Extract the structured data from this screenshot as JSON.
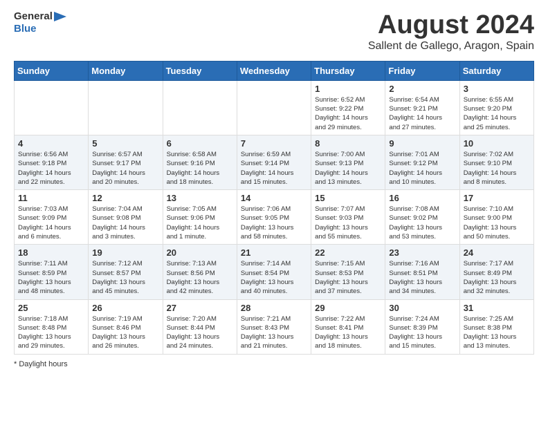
{
  "logo": {
    "general": "General",
    "blue": "Blue"
  },
  "title": "August 2024",
  "subtitle": "Sallent de Gallego, Aragon, Spain",
  "days_of_week": [
    "Sunday",
    "Monday",
    "Tuesday",
    "Wednesday",
    "Thursday",
    "Friday",
    "Saturday"
  ],
  "weeks": [
    [
      {
        "day": "",
        "info": ""
      },
      {
        "day": "",
        "info": ""
      },
      {
        "day": "",
        "info": ""
      },
      {
        "day": "",
        "info": ""
      },
      {
        "day": "1",
        "info": "Sunrise: 6:52 AM\nSunset: 9:22 PM\nDaylight: 14 hours\nand 29 minutes."
      },
      {
        "day": "2",
        "info": "Sunrise: 6:54 AM\nSunset: 9:21 PM\nDaylight: 14 hours\nand 27 minutes."
      },
      {
        "day": "3",
        "info": "Sunrise: 6:55 AM\nSunset: 9:20 PM\nDaylight: 14 hours\nand 25 minutes."
      }
    ],
    [
      {
        "day": "4",
        "info": "Sunrise: 6:56 AM\nSunset: 9:18 PM\nDaylight: 14 hours\nand 22 minutes."
      },
      {
        "day": "5",
        "info": "Sunrise: 6:57 AM\nSunset: 9:17 PM\nDaylight: 14 hours\nand 20 minutes."
      },
      {
        "day": "6",
        "info": "Sunrise: 6:58 AM\nSunset: 9:16 PM\nDaylight: 14 hours\nand 18 minutes."
      },
      {
        "day": "7",
        "info": "Sunrise: 6:59 AM\nSunset: 9:14 PM\nDaylight: 14 hours\nand 15 minutes."
      },
      {
        "day": "8",
        "info": "Sunrise: 7:00 AM\nSunset: 9:13 PM\nDaylight: 14 hours\nand 13 minutes."
      },
      {
        "day": "9",
        "info": "Sunrise: 7:01 AM\nSunset: 9:12 PM\nDaylight: 14 hours\nand 10 minutes."
      },
      {
        "day": "10",
        "info": "Sunrise: 7:02 AM\nSunset: 9:10 PM\nDaylight: 14 hours\nand 8 minutes."
      }
    ],
    [
      {
        "day": "11",
        "info": "Sunrise: 7:03 AM\nSunset: 9:09 PM\nDaylight: 14 hours\nand 6 minutes."
      },
      {
        "day": "12",
        "info": "Sunrise: 7:04 AM\nSunset: 9:08 PM\nDaylight: 14 hours\nand 3 minutes."
      },
      {
        "day": "13",
        "info": "Sunrise: 7:05 AM\nSunset: 9:06 PM\nDaylight: 14 hours\nand 1 minute."
      },
      {
        "day": "14",
        "info": "Sunrise: 7:06 AM\nSunset: 9:05 PM\nDaylight: 13 hours\nand 58 minutes."
      },
      {
        "day": "15",
        "info": "Sunrise: 7:07 AM\nSunset: 9:03 PM\nDaylight: 13 hours\nand 55 minutes."
      },
      {
        "day": "16",
        "info": "Sunrise: 7:08 AM\nSunset: 9:02 PM\nDaylight: 13 hours\nand 53 minutes."
      },
      {
        "day": "17",
        "info": "Sunrise: 7:10 AM\nSunset: 9:00 PM\nDaylight: 13 hours\nand 50 minutes."
      }
    ],
    [
      {
        "day": "18",
        "info": "Sunrise: 7:11 AM\nSunset: 8:59 PM\nDaylight: 13 hours\nand 48 minutes."
      },
      {
        "day": "19",
        "info": "Sunrise: 7:12 AM\nSunset: 8:57 PM\nDaylight: 13 hours\nand 45 minutes."
      },
      {
        "day": "20",
        "info": "Sunrise: 7:13 AM\nSunset: 8:56 PM\nDaylight: 13 hours\nand 42 minutes."
      },
      {
        "day": "21",
        "info": "Sunrise: 7:14 AM\nSunset: 8:54 PM\nDaylight: 13 hours\nand 40 minutes."
      },
      {
        "day": "22",
        "info": "Sunrise: 7:15 AM\nSunset: 8:53 PM\nDaylight: 13 hours\nand 37 minutes."
      },
      {
        "day": "23",
        "info": "Sunrise: 7:16 AM\nSunset: 8:51 PM\nDaylight: 13 hours\nand 34 minutes."
      },
      {
        "day": "24",
        "info": "Sunrise: 7:17 AM\nSunset: 8:49 PM\nDaylight: 13 hours\nand 32 minutes."
      }
    ],
    [
      {
        "day": "25",
        "info": "Sunrise: 7:18 AM\nSunset: 8:48 PM\nDaylight: 13 hours\nand 29 minutes."
      },
      {
        "day": "26",
        "info": "Sunrise: 7:19 AM\nSunset: 8:46 PM\nDaylight: 13 hours\nand 26 minutes."
      },
      {
        "day": "27",
        "info": "Sunrise: 7:20 AM\nSunset: 8:44 PM\nDaylight: 13 hours\nand 24 minutes."
      },
      {
        "day": "28",
        "info": "Sunrise: 7:21 AM\nSunset: 8:43 PM\nDaylight: 13 hours\nand 21 minutes."
      },
      {
        "day": "29",
        "info": "Sunrise: 7:22 AM\nSunset: 8:41 PM\nDaylight: 13 hours\nand 18 minutes."
      },
      {
        "day": "30",
        "info": "Sunrise: 7:24 AM\nSunset: 8:39 PM\nDaylight: 13 hours\nand 15 minutes."
      },
      {
        "day": "31",
        "info": "Sunrise: 7:25 AM\nSunset: 8:38 PM\nDaylight: 13 hours\nand 13 minutes."
      }
    ]
  ],
  "footer": "Daylight hours"
}
